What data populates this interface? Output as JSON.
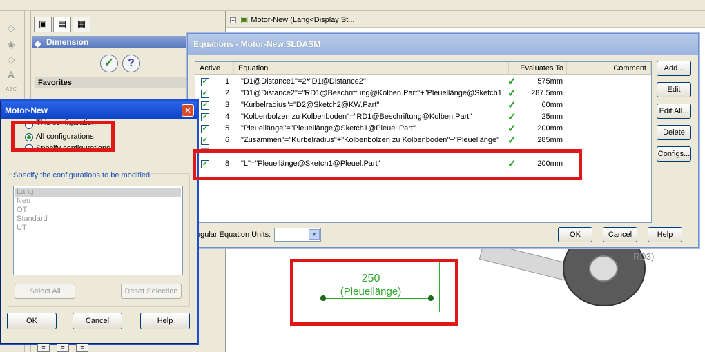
{
  "pm": {
    "panel_title": "Dimension",
    "favorites_label": "Favorites"
  },
  "tree": {
    "root_label": "Motor-New  (Lang<Display St..."
  },
  "graphics": {
    "dimension_value": "250",
    "dimension_name": "(Pleuellänge)",
    "label_partial": "RD3)"
  },
  "equations": {
    "title": "Equations - Motor-New.SLDASM",
    "columns": {
      "active": "Active",
      "equation": "Equation",
      "evaluates": "Evaluates To",
      "comment": "Comment"
    },
    "rows": [
      {
        "num": "1",
        "eq": "\"D1@Distance1\"=2*\"D1@Distance2\"",
        "val": "575mm"
      },
      {
        "num": "2",
        "eq": "\"D1@Distance2\"=\"RD1@Beschriftung@Kolben.Part\"+\"Pleuellänge@Sketch1...",
        "val": "287.5mm"
      },
      {
        "num": "3",
        "eq": "\"Kurbelradius\"=\"D2@Sketch2@KW.Part\"",
        "val": "60mm"
      },
      {
        "num": "4",
        "eq": "\"Kolbenbolzen zu Kolbenboden\"=\"RD1@Beschriftung@Kolben.Part\"",
        "val": "25mm"
      },
      {
        "num": "5",
        "eq": "\"Pleuellänge\"=\"Pleuellänge@Sketch1@Pleuel.Part\"",
        "val": "200mm"
      },
      {
        "num": "6",
        "eq": "\"Zusammen\"=\"Kurbelradius\"+\"Kolbenbolzen zu Kolbenboden\"+\"Pleuellänge\"",
        "val": "285mm"
      },
      {
        "num": "8",
        "eq": "\"L\"=\"Pleuellänge@Sketch1@Pleuel.Part\"",
        "val": "200mm"
      }
    ],
    "units_label": "ngular Equation Units:",
    "buttons": {
      "add": "Add...",
      "edit": "Edit",
      "edit_all": "Edit All...",
      "delete": "Delete",
      "configs": "Configs...",
      "ok": "OK",
      "cancel": "Cancel",
      "help": "Help"
    }
  },
  "motor_new": {
    "title": "Motor-New",
    "opt_this": "This configuration",
    "opt_all": "All configurations",
    "opt_specify": "Specify configurations",
    "group_label": "Specify the configurations to be modified",
    "configs": [
      "Lang",
      "Neu",
      "OT",
      "Standard",
      "UT"
    ],
    "select_all": "Select All",
    "reset_selection": "Reset Selection",
    "ok": "OK",
    "cancel": "Cancel",
    "help": "Help"
  },
  "colors": {
    "highlight": "#e01717",
    "check_green": "#21a121",
    "title_blue": "#0b43c8"
  }
}
